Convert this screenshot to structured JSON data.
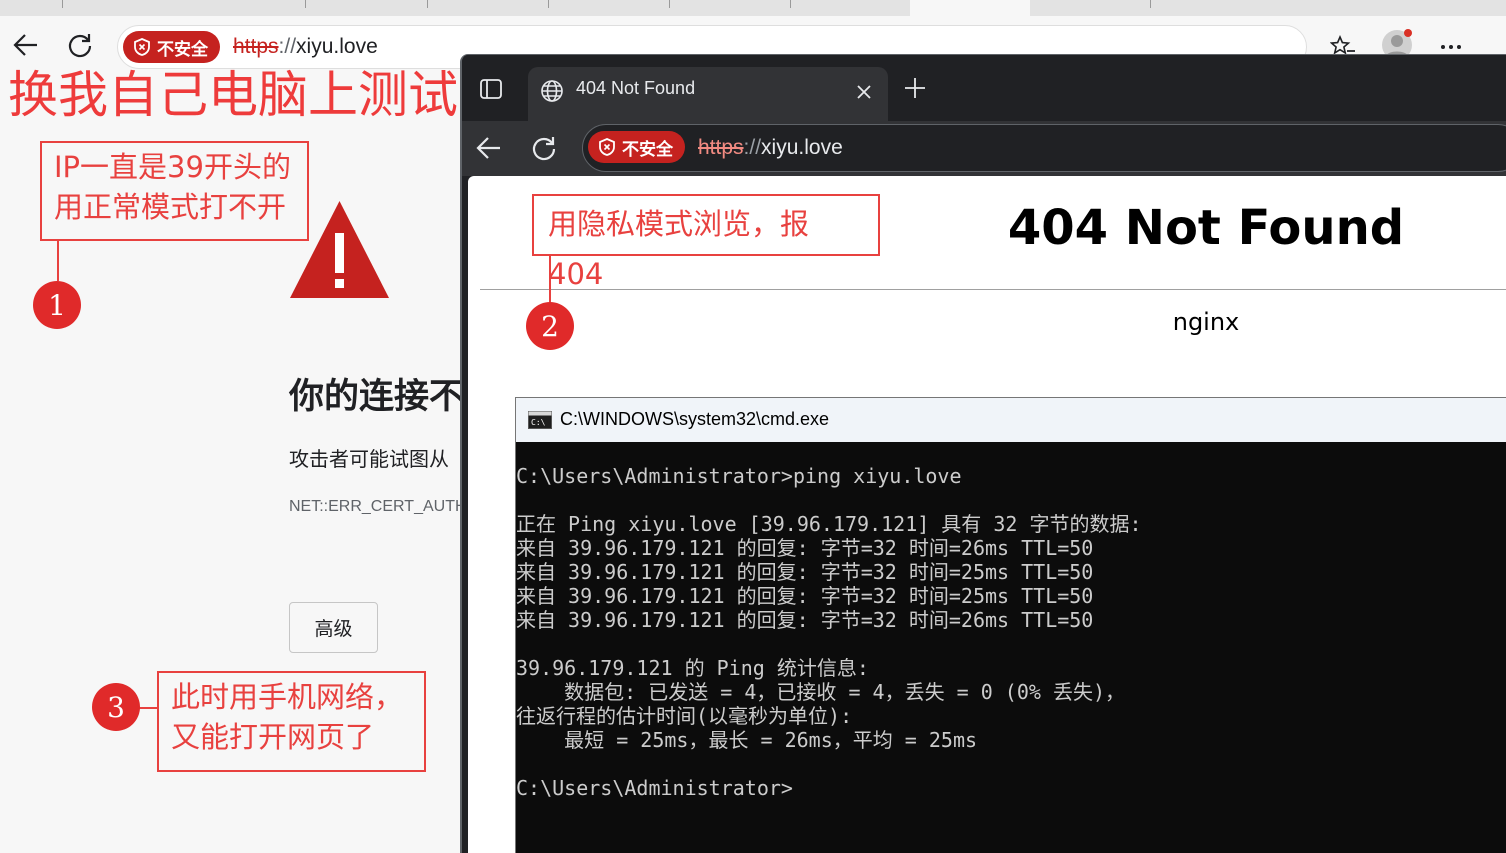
{
  "back_browser": {
    "security_badge": "不安全",
    "url_scheme": "https",
    "url_sep": "://",
    "url_host": "xiyu.love",
    "error_page": {
      "title": "你的连接不",
      "body": "攻击者可能试图从",
      "error_code": "NET::ERR_CERT_AUTH",
      "advanced_button": "高级"
    }
  },
  "front_browser": {
    "tab_title": "404 Not Found",
    "security_badge": "不安全",
    "url_scheme": "https",
    "url_sep": "://",
    "url_host": "xiyu.love",
    "page": {
      "heading": "404 Not Found",
      "server": "nginx"
    }
  },
  "cmd": {
    "title": "C:\\WINDOWS\\system32\\cmd.exe",
    "lines": [
      "C:\\Users\\Administrator>ping xiyu.love",
      "",
      "正在 Ping xiyu.love [39.96.179.121] 具有 32 字节的数据:",
      "来自 39.96.179.121 的回复: 字节=32 时间=26ms TTL=50",
      "来自 39.96.179.121 的回复: 字节=32 时间=25ms TTL=50",
      "来自 39.96.179.121 的回复: 字节=32 时间=25ms TTL=50",
      "来自 39.96.179.121 的回复: 字节=32 时间=26ms TTL=50",
      "",
      "39.96.179.121 的 Ping 统计信息:",
      "    数据包: 已发送 = 4，已接收 = 4，丢失 = 0 (0% 丢失)，",
      "往返行程的估计时间(以毫秒为单位):",
      "    最短 = 25ms，最长 = 26ms，平均 = 25ms",
      "",
      "C:\\Users\\Administrator>"
    ]
  },
  "annotations": {
    "headline": "换我自己电脑上测试",
    "callout1": [
      "IP一直是39开头的",
      "用正常模式打不开"
    ],
    "callout2": "用隐私模式浏览，报404",
    "callout3": [
      "此时用手机网络，",
      "又能打开网页了"
    ],
    "num1": "1",
    "num2": "2",
    "num3": "3"
  },
  "colors": {
    "annotation_red": "#e8413f",
    "insecure_badge": "#c5221f",
    "warning_triangle": "#c5221f",
    "cmd_background": "#0c0c0c"
  }
}
